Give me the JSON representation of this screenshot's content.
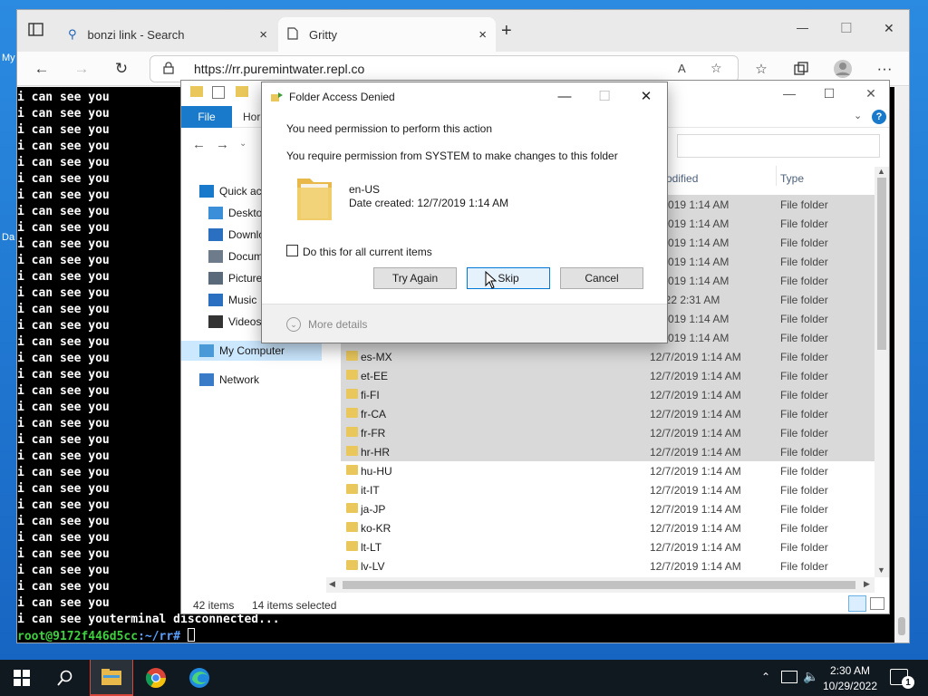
{
  "desktop": {
    "side_label_1": "My",
    "side_label_2": "Da"
  },
  "browser": {
    "tabs": [
      {
        "title": "bonzi link - Search",
        "close": "×"
      },
      {
        "title": "Gritty",
        "close": "×"
      }
    ],
    "new_tab": "+",
    "window_controls": {
      "minimize": "—",
      "maximize": "☐",
      "close": "✕"
    },
    "url": "https://rr.puremintwater.repl.co",
    "nav": {
      "back": "←",
      "forward": "→",
      "reload": "↻",
      "more": "···"
    }
  },
  "terminal": {
    "repeat_line": "i can see you",
    "repeat_count": 32,
    "last_line": "i can see youterminal disconnected...",
    "prompt_user": "root@9172f446d5cc",
    "prompt_path": ":~/rr#"
  },
  "explorer": {
    "ribbon": {
      "file": "File",
      "home": "Hor"
    },
    "help": "?",
    "nav_pane": [
      {
        "label": "Quick ac",
        "icon": "star-icon"
      },
      {
        "label": "Deskto",
        "icon": "desktop-icon"
      },
      {
        "label": "Downlo",
        "icon": "download-icon"
      },
      {
        "label": "Docum",
        "icon": "document-icon"
      },
      {
        "label": "Picture",
        "icon": "picture-icon"
      },
      {
        "label": "Music",
        "icon": "music-icon"
      },
      {
        "label": "Videos",
        "icon": "video-icon"
      },
      {
        "label": "My Computer",
        "icon": "computer-icon"
      },
      {
        "label": "Network",
        "icon": "network-icon"
      }
    ],
    "columns": {
      "date": "e modified",
      "type": "Type"
    },
    "rows": [
      {
        "name": "",
        "date": "/7/2019 1:14 AM",
        "type": "File folder",
        "selected": true
      },
      {
        "name": "",
        "date": "/7/2019 1:14 AM",
        "type": "File folder",
        "selected": true
      },
      {
        "name": "",
        "date": "/7/2019 1:14 AM",
        "type": "File folder",
        "selected": true
      },
      {
        "name": "",
        "date": "/7/2019 1:14 AM",
        "type": "File folder",
        "selected": true
      },
      {
        "name": "",
        "date": "/7/2019 1:14 AM",
        "type": "File folder",
        "selected": true
      },
      {
        "name": "",
        "date": "/2022 2:31 AM",
        "type": "File folder",
        "selected": true
      },
      {
        "name": "",
        "date": "/7/2019 1:14 AM",
        "type": "File folder",
        "selected": true
      },
      {
        "name": "",
        "date": "/7/2019 1:14 AM",
        "type": "File folder",
        "selected": true
      },
      {
        "name": "es-MX",
        "date": "12/7/2019 1:14 AM",
        "type": "File folder",
        "selected": true
      },
      {
        "name": "et-EE",
        "date": "12/7/2019 1:14 AM",
        "type": "File folder",
        "selected": true
      },
      {
        "name": "fi-FI",
        "date": "12/7/2019 1:14 AM",
        "type": "File folder",
        "selected": true
      },
      {
        "name": "fr-CA",
        "date": "12/7/2019 1:14 AM",
        "type": "File folder",
        "selected": true
      },
      {
        "name": "fr-FR",
        "date": "12/7/2019 1:14 AM",
        "type": "File folder",
        "selected": true
      },
      {
        "name": "hr-HR",
        "date": "12/7/2019 1:14 AM",
        "type": "File folder",
        "selected": true
      },
      {
        "name": "hu-HU",
        "date": "12/7/2019 1:14 AM",
        "type": "File folder",
        "selected": false
      },
      {
        "name": "it-IT",
        "date": "12/7/2019 1:14 AM",
        "type": "File folder",
        "selected": false
      },
      {
        "name": "ja-JP",
        "date": "12/7/2019 1:14 AM",
        "type": "File folder",
        "selected": false
      },
      {
        "name": "ko-KR",
        "date": "12/7/2019 1:14 AM",
        "type": "File folder",
        "selected": false
      },
      {
        "name": "lt-LT",
        "date": "12/7/2019 1:14 AM",
        "type": "File folder",
        "selected": false
      },
      {
        "name": "lv-LV",
        "date": "12/7/2019 1:14 AM",
        "type": "File folder",
        "selected": false
      }
    ],
    "status": {
      "items": "42 items",
      "selected": "14 items selected"
    }
  },
  "dialog": {
    "title": "Folder Access Denied",
    "line1": "You need permission to perform this action",
    "line2": "You require permission from SYSTEM to make changes to this folder",
    "folder_name": "en-US",
    "folder_date": "Date created: 12/7/2019 1:14 AM",
    "checkbox_label": "Do this for all current items",
    "buttons": {
      "try_again": "Try Again",
      "skip": "Skip",
      "cancel": "Cancel"
    },
    "more_details": "More details",
    "controls": {
      "minimize": "—",
      "maximize": "☐",
      "close": "✕"
    }
  },
  "taskbar": {
    "time": "2:30 AM",
    "date": "10/29/2022",
    "notifications": "1"
  },
  "colors": {
    "accent": "#0078d7",
    "terminal_green": "#3fcf3f",
    "selection": "#d9d9d9"
  }
}
